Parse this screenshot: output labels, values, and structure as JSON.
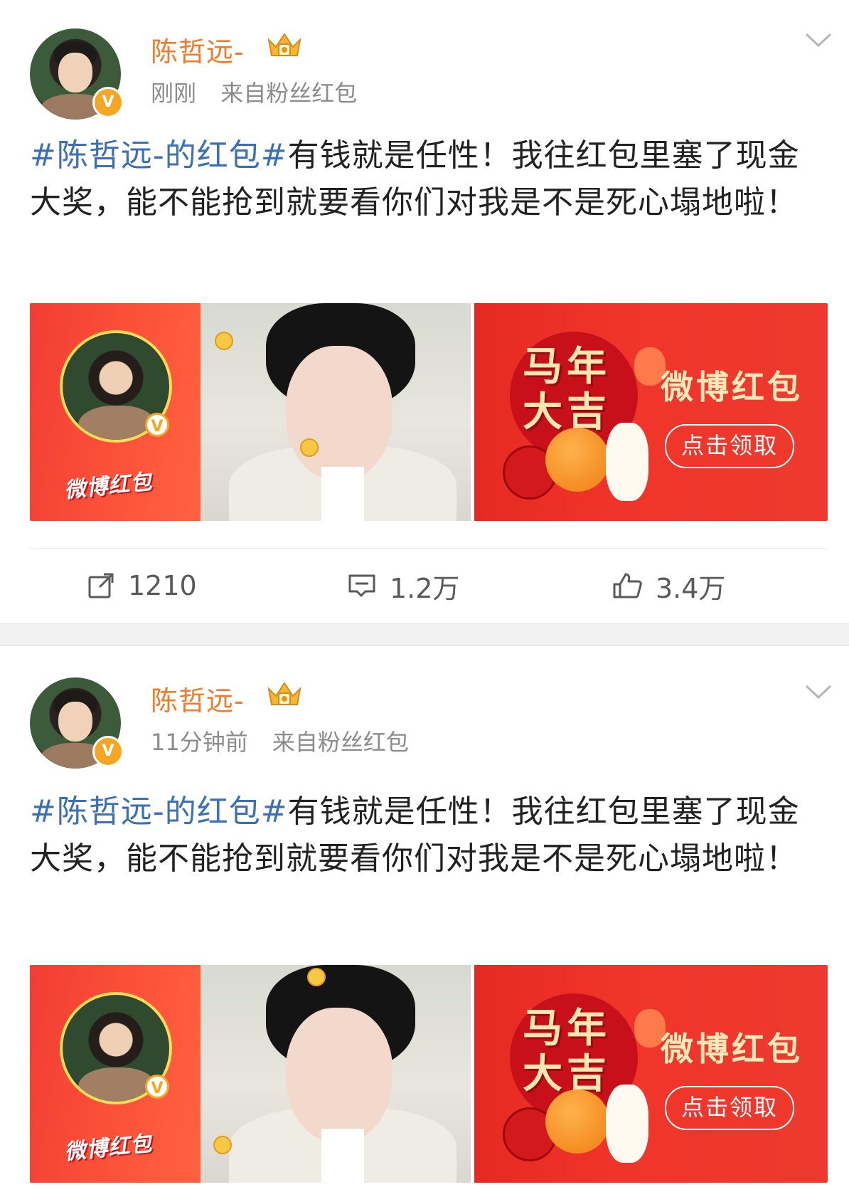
{
  "posts": [
    {
      "username": "陈哲远-",
      "time": "刚刚",
      "source": "来自粉丝红包",
      "hashtag": "#陈哲远-的红包#",
      "body": "有钱就是任性！我往红包里塞了现金大奖，能不能抢到就要看你们对我是不是死心塌地啦！",
      "banner": {
        "logo": "微博红包",
        "lucky": "马年大吉",
        "title": "微博红包",
        "button": "点击领取"
      },
      "actions": {
        "repost": "1210",
        "comment": "1.2万",
        "like": "3.4万"
      }
    },
    {
      "username": "陈哲远-",
      "time": "11分钟前",
      "source": "来自粉丝红包",
      "hashtag": "#陈哲远-的红包#",
      "body": "有钱就是任性！我往红包里塞了现金大奖，能不能抢到就要看你们对我是不是死心塌地啦！",
      "banner": {
        "logo": "微博红包",
        "lucky": "马年大吉",
        "title": "微博红包",
        "button": "点击领取"
      }
    }
  ],
  "icons": [
    "crown-icon",
    "verified-icon",
    "chevron-down-icon",
    "repost-icon",
    "comment-icon",
    "like-icon"
  ],
  "colors": {
    "username": "#f07b2a",
    "hashtag": "#3b6fb6",
    "banner_red": "#f0342a",
    "verified": "#f5a623"
  }
}
